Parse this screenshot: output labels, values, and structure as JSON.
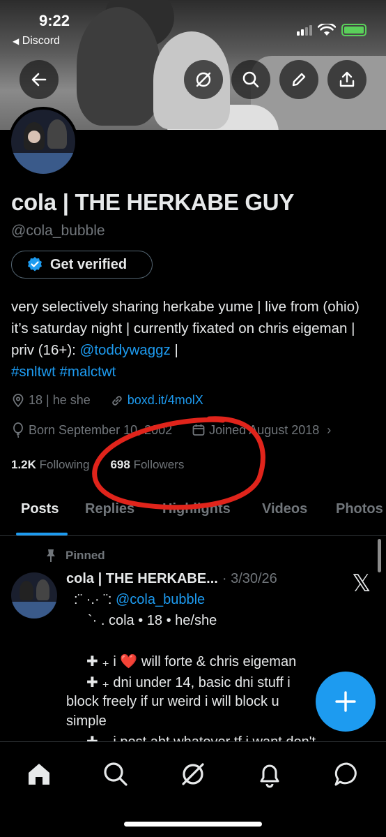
{
  "status_bar": {
    "time": "9:22",
    "back_app": "Discord"
  },
  "profile": {
    "display_name": "cola | THE HERKABE GUY",
    "handle": "@cola_bubble",
    "verify_label": "Get verified",
    "bio_text_1": "very selectively sharing herkabe yume | live from (ohio) it’s saturday night | currently fixated on chris eigeman | priv (16+): ",
    "bio_link_1": "@toddywaggz",
    "bio_text_2": " |",
    "bio_tags": "#snltwt #malctwt",
    "location": "18 | he she",
    "website": "boxd.it/4molX",
    "birthday": "Born September 10, 2002",
    "joined": "Joined August 2018",
    "following_count": "1.2K",
    "following_label": "Following",
    "followers_count": "698",
    "followers_label": "Followers"
  },
  "tabs": [
    "Posts",
    "Replies",
    "Highlights",
    "Videos",
    "Photos"
  ],
  "pinned_post": {
    "pinned_label": "Pinned",
    "author": "cola | THE HERKABE...",
    "date": "· 3/30/26",
    "line1_prefix": ":¨ ·.· ¨: ",
    "line1_mention": "@cola_bubble",
    "line2": "`· .  cola • 18 • he/she",
    "line3": "✚ ₊ i ❤️  will forte & chris eigeman",
    "line4": "✚ ₊ dni under 14, basic dni stuff i",
    "line5": "block freely if ur weird i will block u",
    "line6": "simple",
    "line7": "✚ ₊ i post abt whatever tf i want don't"
  },
  "annotation": {
    "circle_color": "#e0241b"
  },
  "colors": {
    "accent": "#1d9bf0",
    "muted": "#71767b",
    "text": "#e7e9ea"
  }
}
